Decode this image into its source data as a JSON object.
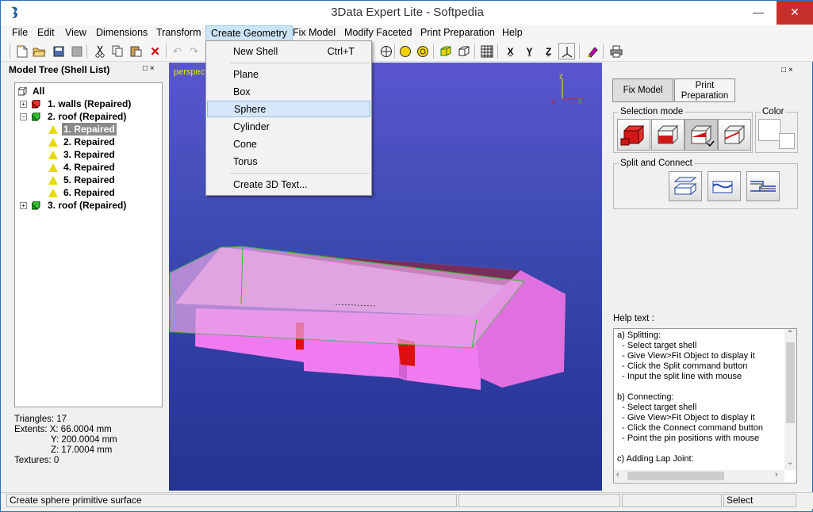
{
  "window": {
    "title": "3Data Expert Lite - Softpedia",
    "minimize": "—",
    "maximize": "☐",
    "close": "✕"
  },
  "menubar": [
    "File",
    "Edit",
    "View",
    "Dimensions",
    "Transform",
    "Create Geometry",
    "Fix Model",
    "Modify Faceted",
    "Print Preparation",
    "Help"
  ],
  "dropdown": {
    "items": [
      {
        "label": "New Shell",
        "shortcut": "Ctrl+T"
      },
      {
        "label": "Plane"
      },
      {
        "label": "Box"
      },
      {
        "label": "Sphere",
        "highlighted": true
      },
      {
        "label": "Cylinder"
      },
      {
        "label": "Cone"
      },
      {
        "label": "Torus"
      },
      {
        "label": "Create 3D Text..."
      }
    ]
  },
  "model_tree": {
    "title": "Model Tree (Shell List)",
    "pin": "□ ×",
    "rows": [
      {
        "label": "All"
      },
      {
        "label": "1.  walls (Repaired)"
      },
      {
        "label": "2.  roof (Repaired)"
      },
      {
        "label": "1. Repaired",
        "selected": true
      },
      {
        "label": "2. Repaired"
      },
      {
        "label": "3. Repaired"
      },
      {
        "label": "4. Repaired"
      },
      {
        "label": "5. Repaired"
      },
      {
        "label": "6. Repaired"
      },
      {
        "label": "3.  roof (Repaired)"
      }
    ]
  },
  "info": {
    "triangles": "Triangles: 17",
    "extents_x": "Extents:  X: 66.0004 mm",
    "extents_y": "Y: 200.0004 mm",
    "extents_z": "Z: 17.0004 mm",
    "textures": "Textures: 0"
  },
  "viewport": {
    "label": "perspective"
  },
  "right_panel": {
    "pin": "□ ×",
    "tab_fix": "Fix Model",
    "tab_print": "Print Preparation",
    "selection_mode": "Selection mode",
    "color": "Color",
    "split_connect": "Split and Connect",
    "help_label": "Help text :",
    "help_text": "a) Splitting:\n  - Select target shell\n  - Give View>Fit Object to display it\n  - Click the Split command button\n  - Input the split line with mouse\n\nb) Connecting:\n  - Select target shell\n  - Give View>Fit Object to display it\n  - Click the Connect command button\n  - Point the pin positions with mouse\n\nc) Adding Lap Joint:"
  },
  "status": {
    "message": "Create sphere primitive surface",
    "mode": "Select"
  },
  "colors": {
    "viewport": "#3d4bb2",
    "walls": "#f07af0",
    "roof": "#d8a0d8",
    "accent": "#cce4f7"
  }
}
